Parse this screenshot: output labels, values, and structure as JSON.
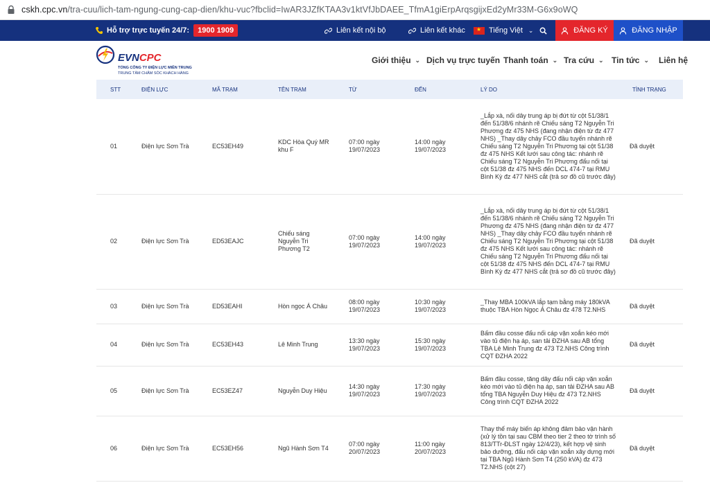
{
  "browser": {
    "url_host": "cskh.cpc.vn",
    "url_path": "/tra-cuu/lich-tam-ngung-cung-cap-dien/khu-vuc?fbclid=IwAR3JZfKTAA3v1ktVfJbDAEE_TfmA1giErpArqsgijxEd2yMr33M-G6x9oWQ"
  },
  "topbar": {
    "support_label": "Hỗ trợ trực tuyến 24/7:",
    "hotline": "1900 1909",
    "internal_link": "Liên kết nội bộ",
    "other_link": "Liên kết khác",
    "language": "Tiếng Việt",
    "register": "ĐĂNG KÝ",
    "login": "ĐĂNG NHẬP"
  },
  "logo": {
    "brand_evn": "EVN",
    "brand_cpc": "CPC",
    "line1": "TỔNG CÔNG TY ĐIỆN LỰC MIỀN TRUNG",
    "line2": "TRUNG TÂM CHĂM SÓC KHÁCH HÀNG"
  },
  "nav": {
    "items": [
      {
        "label": "Giới thiệu",
        "has_dropdown": true
      },
      {
        "label": "Dịch vụ trực tuyến",
        "has_dropdown": false
      },
      {
        "label": "Thanh toán",
        "has_dropdown": true
      },
      {
        "label": "Tra cứu",
        "has_dropdown": true
      },
      {
        "label": "Tin tức",
        "has_dropdown": true
      },
      {
        "label": "Liên hệ",
        "has_dropdown": false
      }
    ]
  },
  "table": {
    "headers": [
      "STT",
      "ĐIỆN LỰC",
      "MÃ TRẠM",
      "TÊN TRẠM",
      "TỪ",
      "ĐẾN",
      "LÝ DO",
      "TÌNH TRẠNG"
    ],
    "rows": [
      {
        "stt": "01",
        "dien_luc": "Điện lực Sơn Trà",
        "ma_tram": "EC53EH49",
        "ten_tram": "KDC Hòa Quý MR khu F",
        "tu": "07:00 ngày 19/07/2023",
        "den": "14:00 ngày 19/07/2023",
        "ly_do": "_Lắp xà, nối dây trung áp bị đứt từ cột 51/38/1 đến 51/38/6 nhánh rẽ Chiếu sáng T2 Nguyễn Tri Phương đz 475 NHS (đang nhận điện từ đz 477 NHS) _Thay dây chảy FCO đầu tuyến nhánh rẽ Chiếu sáng T2 Nguyễn Tri Phương tại cột 51/38 đz 475 NHS Kết lưới sau công tác: nhánh rẽ Chiếu sáng T2 Nguyễn Tri Phương đấu nối tại cột 51/38 đz 475 NHS đến DCL 474-7 tại RMU Bình Kỳ đz 477 NHS cắt (trả sơ đồ cũ trước đây)",
        "tinh_trang": "Đã duyệt"
      },
      {
        "stt": "02",
        "dien_luc": "Điện lực Sơn Trà",
        "ma_tram": "ED53EAJC",
        "ten_tram": "Chiếu sáng Nguyễn Tri Phương T2",
        "tu": "07:00 ngày 19/07/2023",
        "den": "14:00 ngày 19/07/2023",
        "ly_do": "_Lắp xà, nối dây trung áp bị đứt từ cột 51/38/1 đến 51/38/6 nhánh rẽ Chiếu sáng T2 Nguyễn Tri Phương đz 475 NHS (đang nhận điện từ đz 477 NHS) _Thay dây chảy FCO đầu tuyến nhánh rẽ Chiếu sáng T2 Nguyễn Tri Phương tại cột 51/38 đz 475 NHS Kết lưới sau công tác: nhánh rẽ Chiếu sáng T2 Nguyễn Tri Phương đấu nối tại cột 51/38 đz 475 NHS đến DCL 474-7 tại RMU Bình Kỳ đz 477 NHS cắt (trả sơ đồ cũ trước đây)",
        "tinh_trang": "Đã duyệt"
      },
      {
        "stt": "03",
        "dien_luc": "Điện lực Sơn Trà",
        "ma_tram": "ED53EAHI",
        "ten_tram": "Hòn ngọc Á Châu",
        "tu": "08:00 ngày 19/07/2023",
        "den": "10:30 ngày 19/07/2023",
        "ly_do": "_Thay MBA 100kVA lắp tạm bằng máy 180kVA thuộc TBA Hòn Ngọc Á Châu đz 478 T2.NHS",
        "tinh_trang": "Đã duyệt"
      },
      {
        "stt": "04",
        "dien_luc": "Điện lực Sơn Trà",
        "ma_tram": "EC53EH43",
        "ten_tram": "Lê Minh Trung",
        "tu": "13:30 ngày 19/07/2023",
        "den": "15:30 ngày 19/07/2023",
        "ly_do": "Bấm đầu cosse đấu nối cáp vặn xoắn kéo mới vào tủ điện hạ áp, san tải ĐZHA sau AB tổng TBA Lê Minh Trung đz 473 T2.NHS Công trình CQT ĐZHA 2022",
        "tinh_trang": "Đã duyệt"
      },
      {
        "stt": "05",
        "dien_luc": "Điện lực Sơn Trà",
        "ma_tram": "EC53EZ47",
        "ten_tram": "Nguyễn Duy Hiệu",
        "tu": "14:30 ngày 19/07/2023",
        "den": "17:30 ngày 19/07/2023",
        "ly_do": "Bấm đầu cosse, tăng dây đấu nối cáp vặn xoắn kéo mới vào tủ điện hạ áp, san tải ĐZHA sau AB tổng TBA Nguyễn Duy Hiệu đz 473 T2.NHS Công trình CQT ĐZHA 2022",
        "tinh_trang": "Đã duyệt"
      },
      {
        "stt": "06",
        "dien_luc": "Điện lực Sơn Trà",
        "ma_tram": "EC53EH56",
        "ten_tram": "Ngũ Hành Sơn T4",
        "tu": "07:00 ngày 20/07/2023",
        "den": "11:00 ngày 20/07/2023",
        "ly_do": "Thay thế máy biến áp không đảm bảo vận hành (xử lý tồn tại sau CBM theo tier 2 theo tờ trình số 813/TTr-ĐLST ngày 12/4/23), kết hợp vệ sinh bảo dưỡng, đấu nối cáp vặn xoắn xây dựng mới tại TBA Ngũ Hành Sơn T4 (250 kVA) đz 473 T2.NHS (cột 27)",
        "tinh_trang": "Đã duyệt"
      }
    ]
  }
}
